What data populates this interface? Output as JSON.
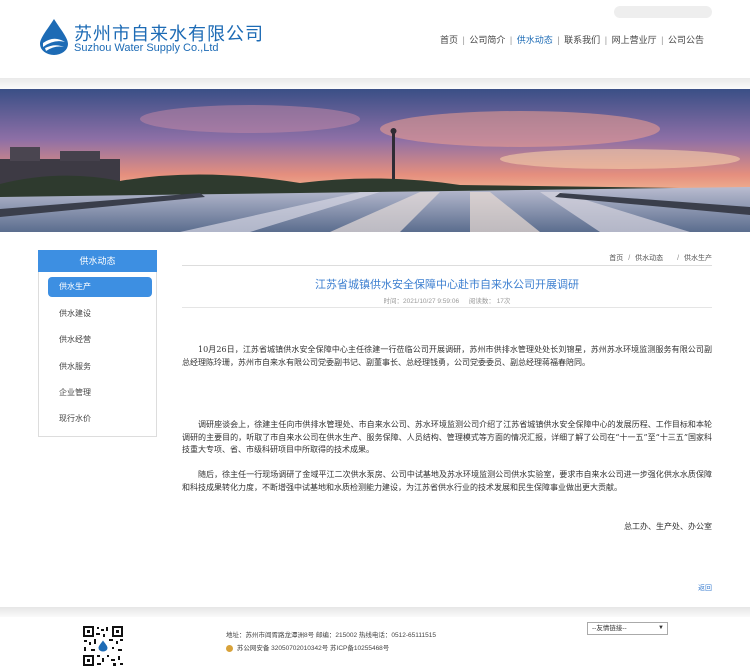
{
  "header": {
    "company_cn": "苏州市自来水有限公司",
    "company_en": "Suzhou Water Supply Co.,Ltd",
    "logo_icon": "water-drop-logo-icon"
  },
  "nav": {
    "items": [
      {
        "label": "首页"
      },
      {
        "label": "公司简介"
      },
      {
        "label": "供水动态",
        "active": true
      },
      {
        "label": "联系我们"
      },
      {
        "label": "网上营业厅"
      },
      {
        "label": "公司公告"
      }
    ],
    "separator": "|"
  },
  "sidebar": {
    "title": "供水动态",
    "items": [
      {
        "label": "供水生产",
        "active": true
      },
      {
        "label": "供水建设"
      },
      {
        "label": "供水经营"
      },
      {
        "label": "供水服务"
      },
      {
        "label": "企业管理"
      },
      {
        "label": "现行水价"
      }
    ]
  },
  "breadcrumb": {
    "home": "首页",
    "section": "供水动态",
    "current": "供水生产",
    "separator": "/"
  },
  "article": {
    "title": "江苏省城镇供水安全保障中心赴市自来水公司开展调研",
    "time_label": "时间：2021/10/27 9:59:06",
    "views_label": "阅读数：  17次",
    "paragraphs": [
      "10月26日，江苏省城镇供水安全保障中心主任徐建一行莅临公司开展调研，苏州市供排水管理处处长刘锦星，苏州苏水环境监测服务有限公司副总经理陈玲珊，苏州市自来水有限公司党委副书记、副董事长、总经理钱勇，公司党委委员、副总经理蒋福春陪同。",
      "调研座谈会上，徐建主任向市供排水管理处、市自来水公司、苏水环境监测公司介绍了江苏省城镇供水安全保障中心的发展历程、工作目标和本轮调研的主要目的，听取了市自来水公司在供水生产、服务保障、人员结构、管理模式等方面的情况汇报，详细了解了公司在“十一五”至“十三五”国家科技重大专项、省、市级科研项目中所取得的技术成果。",
      "随后，徐主任一行现场调研了金域平江二次供水泵房、公司中试基地及苏水环境监测公司供水实验室，要求市自来水公司进一步强化供水水质保障和科技成果转化力度，不断增强中试基地和水质检测能力建设，为江苏省供水行业的技术发展和民生保障事业做出更大贡献。"
    ],
    "signature": "总工办、生产处、办公室",
    "back_label": "返回"
  },
  "footer": {
    "address": "地址：苏州市阊胥路龙潭洲8号   邮编：215002   热线电话：0512-65111515",
    "police_record": "苏公网安备 32050702010342号",
    "icp": "苏ICP备10255468号",
    "links_select": "--友情链接--"
  },
  "colors": {
    "brand_blue": "#1d6bb5",
    "accent_blue": "#3d8fe2"
  }
}
